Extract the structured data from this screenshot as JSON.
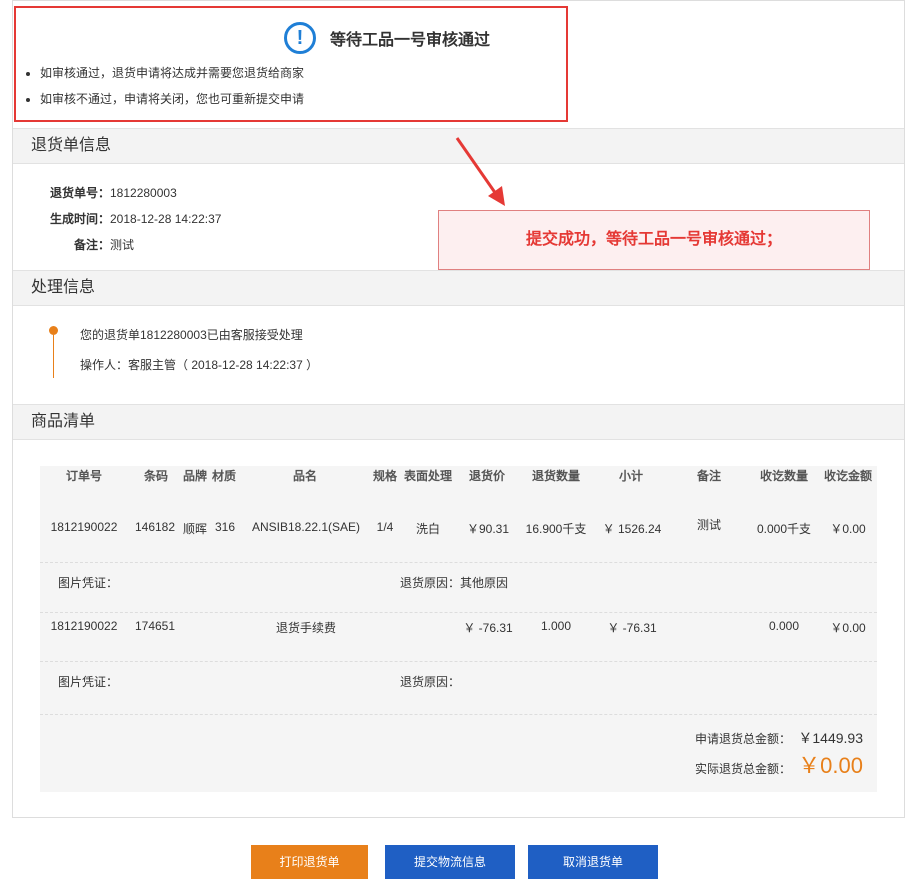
{
  "notice": {
    "title": "等待工品一号审核通过",
    "icon": "exclamation-circle-icon",
    "lines": [
      "如审核通过，退货申请将达成并需要您退货给商家",
      "如审核不通过，申请将关闭，您也可重新提交申请"
    ]
  },
  "callout": {
    "text": "提交成功，等待工品一号审核通过；"
  },
  "return_info": {
    "heading": "退货单信息",
    "rows": [
      {
        "k": "退货单号：",
        "v": "1812280003"
      },
      {
        "k": "生成时间：",
        "v": "2018-12-28 14:22:37"
      },
      {
        "k": "备注：",
        "v": "测试"
      }
    ]
  },
  "process": {
    "heading": "处理信息",
    "line1": "您的退货单1812280003已由客服接受处理",
    "line2": "操作人：客服主管（ 2018-12-28 14:22:37 ）"
  },
  "goods": {
    "heading": "商品清单",
    "headers": [
      "订单号",
      "条码",
      "品牌",
      "材质",
      "品名",
      "规格",
      "表面处理",
      "退货价",
      "退货数量",
      "小计",
      "备注",
      "收讫数量",
      "收讫金额"
    ],
    "rows": [
      {
        "order": "1812190022",
        "barcode": "146182",
        "brand": "顺晖",
        "material": "316",
        "name": "ANSIB18.22.1(SAE)",
        "spec": "1/4",
        "surface": "洗白",
        "price": "￥90.31",
        "qty": "16.900千支",
        "subtotal": "￥ 1526.24",
        "note": "测试",
        "rcv_qty": "0.000千支",
        "rcv_amt": "￥0.00",
        "photo_label": "图片凭证：",
        "reason": "退货原因：其他原因"
      },
      {
        "order": "1812190022",
        "barcode": "174651",
        "brand": "",
        "material": "",
        "name": "退货手续费",
        "spec": "",
        "surface": "",
        "price": "￥ -76.31",
        "qty": "1.000",
        "subtotal": "￥ -76.31",
        "note": "",
        "rcv_qty": "0.000",
        "rcv_amt": "￥0.00",
        "photo_label": "图片凭证：",
        "reason": "退货原因："
      }
    ],
    "apply_total_label": "申请退货总金额：",
    "apply_total": "￥1449.93",
    "actual_total_label": "实际退货总金额：",
    "actual_total": "￥0.00"
  },
  "buttons": {
    "print": "打印退货单",
    "logistics": "提交物流信息",
    "cancel": "取消退货单"
  },
  "colors": {
    "accent_orange": "#e8801a",
    "blue": "#1f5fc4",
    "red": "#e53935"
  }
}
